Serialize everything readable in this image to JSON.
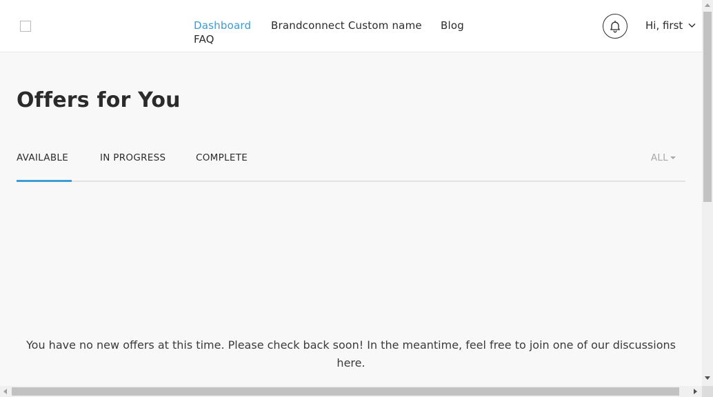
{
  "header": {
    "nav": [
      {
        "label": "Dashboard",
        "active": true
      },
      {
        "label": "Brandconnect Custom name",
        "active": false
      },
      {
        "label": "Blog",
        "active": false
      },
      {
        "label": "FAQ",
        "active": false
      }
    ],
    "user_greeting": "Hi, first"
  },
  "main": {
    "title": "Offers for You",
    "tabs": [
      {
        "label": "AVAILABLE",
        "active": true
      },
      {
        "label": "IN PROGRESS",
        "active": false
      },
      {
        "label": "COMPLETE",
        "active": false
      }
    ],
    "filter": {
      "selected": "ALL"
    },
    "empty_message": "You have no new offers at this time. Please check back soon! In the meantime, feel free to join one of our discussions here."
  },
  "colors": {
    "accent": "#3a9bd5",
    "text": "#2b2b2b",
    "background": "#f8f8f8",
    "header_bg": "#ffffff",
    "muted": "#a8a8a8"
  },
  "icons": [
    "logo-placeholder-icon",
    "bell-icon",
    "chevron-down-icon",
    "caret-down-icon"
  ]
}
